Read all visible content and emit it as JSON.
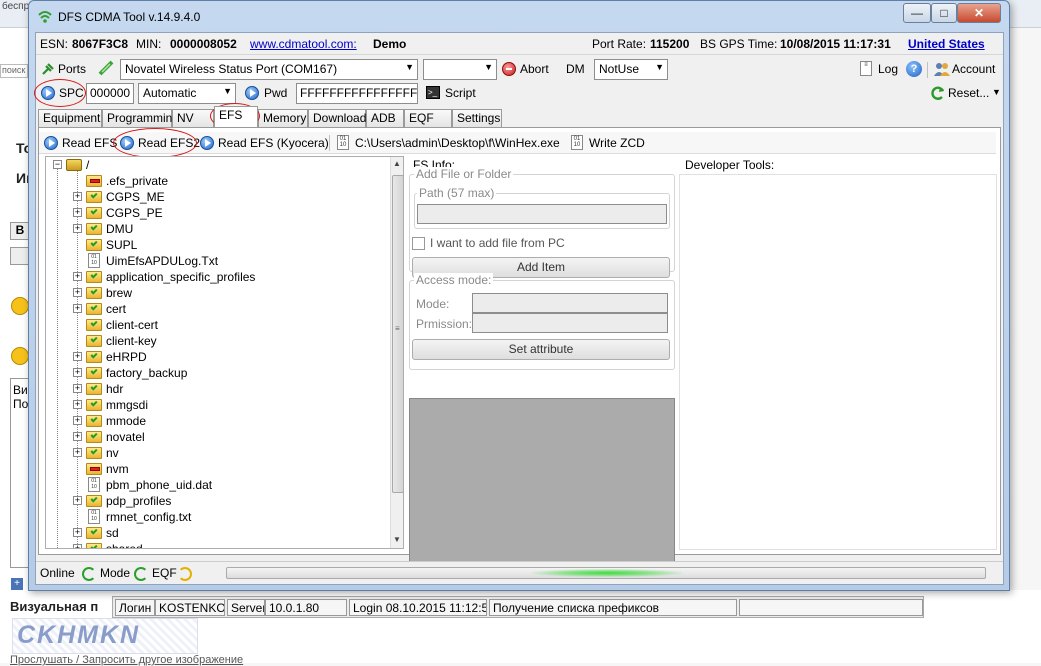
{
  "background": {
    "top_text": "беспр",
    "search_stub": "поиск",
    "letters": [
      "То",
      "Иг"
    ],
    "format_button": "B",
    "textarea_lines": [
      "Ви",
      "По"
    ],
    "visual_label": "Визуальная п",
    "status_cells": [
      "Логин",
      "KOSTENKO.",
      "Server",
      "10.0.1.80",
      "Login 08.10.2015 11:12:59",
      "Получение списка префиксов"
    ],
    "captcha_text": "CKHMKN",
    "refresh_link": "Прослушать / Запросить другое изображение"
  },
  "window": {
    "title": "DFS CDMA Tool v.14.9.4.0",
    "buttons": [
      "minimize",
      "maximize",
      "close"
    ]
  },
  "info": {
    "esn_label": "ESN:",
    "esn_value": "8067F3C8",
    "min_label": "MIN:",
    "min_value": "0000008052",
    "website": "www.cdmatool.com:",
    "edition": "Demo",
    "port_rate_label": "Port Rate:",
    "port_rate_value": "115200",
    "gps_label": "BS GPS Time:",
    "gps_value": "10/08/2015 11:17:31",
    "region_link": "United States"
  },
  "toolbar": {
    "ports_label": "Ports",
    "port_selected": "Novatel Wireless Status Port (COM167)",
    "port2_selected": "",
    "abort_label": "Abort",
    "dm_label": "DM",
    "dm_selected": "NotUse",
    "log_label": "Log",
    "help_label": "?",
    "account_label": "Account",
    "spc_label": "SPC",
    "spc_value": "000000",
    "spc_mode": "Automatic",
    "pwd_label": "Pwd",
    "pwd_value": "FFFFFFFFFFFFFFFF",
    "script_label": "Script",
    "reset_label": "Reset..."
  },
  "tabs": [
    "Equipment",
    "Programming",
    "NV",
    "EFS",
    "Memory",
    "Download",
    "ADB",
    "EQF",
    "Settings"
  ],
  "active_tab": "EFS",
  "efs_toolbar": {
    "read_efs": "Read EFS",
    "read_efs2": "Read EFS2",
    "read_efs_kyocera": "Read EFS (Kyocera)",
    "winhex_path": "C:\\Users\\admin\\Desktop\\f\\WinHex.exe",
    "write_zcd": "Write ZCD"
  },
  "tree": {
    "root": "/",
    "items": [
      {
        "name": ".efs_private",
        "type": "folder-red",
        "expandable": false
      },
      {
        "name": "CGPS_ME",
        "type": "folder",
        "expandable": true
      },
      {
        "name": "CGPS_PE",
        "type": "folder",
        "expandable": true
      },
      {
        "name": "DMU",
        "type": "folder",
        "expandable": true
      },
      {
        "name": "SUPL",
        "type": "folder",
        "expandable": false
      },
      {
        "name": "UimEfsAPDULog.Txt",
        "type": "file",
        "expandable": false
      },
      {
        "name": "application_specific_profiles",
        "type": "folder",
        "expandable": true
      },
      {
        "name": "brew",
        "type": "folder",
        "expandable": true
      },
      {
        "name": "cert",
        "type": "folder",
        "expandable": true
      },
      {
        "name": "client-cert",
        "type": "folder",
        "expandable": false
      },
      {
        "name": "client-key",
        "type": "folder",
        "expandable": false
      },
      {
        "name": "eHRPD",
        "type": "folder",
        "expandable": true
      },
      {
        "name": "factory_backup",
        "type": "folder",
        "expandable": true
      },
      {
        "name": "hdr",
        "type": "folder",
        "expandable": true
      },
      {
        "name": "mmgsdi",
        "type": "folder",
        "expandable": true
      },
      {
        "name": "mmode",
        "type": "folder",
        "expandable": true
      },
      {
        "name": "novatel",
        "type": "folder",
        "expandable": true
      },
      {
        "name": "nv",
        "type": "folder",
        "expandable": true
      },
      {
        "name": "nvm",
        "type": "folder-red",
        "expandable": false
      },
      {
        "name": "pbm_phone_uid.dat",
        "type": "file",
        "expandable": false
      },
      {
        "name": "pdp_profiles",
        "type": "folder",
        "expandable": true
      },
      {
        "name": "rmnet_config.txt",
        "type": "file",
        "expandable": false
      },
      {
        "name": "sd",
        "type": "folder",
        "expandable": true
      },
      {
        "name": "shared",
        "type": "folder",
        "expandable": true
      }
    ]
  },
  "fs_info": {
    "title": "FS Info:",
    "add_group": "Add File or Folder",
    "path_group": "Path (57 max)",
    "path_value": "",
    "add_from_pc": "I want to add file from PC",
    "add_item": "Add Item",
    "access_group": "Access mode:",
    "mode_label": "Mode:",
    "permission_label": "Prmission:",
    "set_attribute": "Set attribute"
  },
  "developer_tools": {
    "title": "Developer Tools:"
  },
  "statusbar": {
    "online": "Online",
    "mode": "Mode",
    "eqf": "EQF",
    "progress": 0.5
  },
  "colors": {
    "annotation_red": "#d81818",
    "title_bar": "#c5d8ef",
    "link_blue": "#0000cc",
    "folder_yellow": "#e8b531"
  }
}
